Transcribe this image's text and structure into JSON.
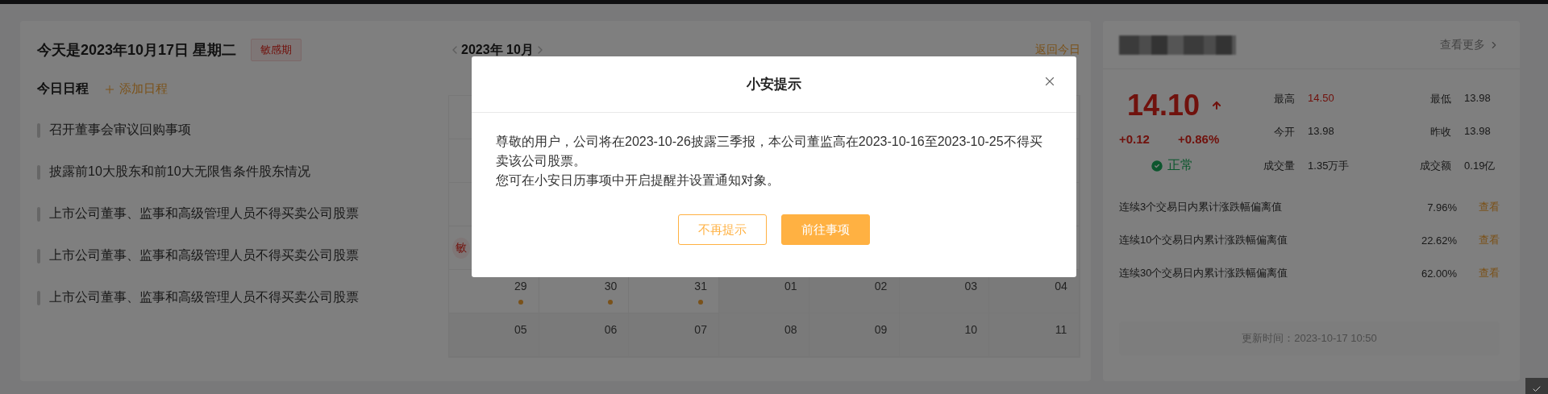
{
  "left_card": {
    "title": "今天是2023年10月17日 星期二",
    "badge": "敏感期",
    "schedule_heading": "今日日程",
    "add_link": "添加日程",
    "schedule": [
      "召开董事会审议回购事项",
      "披露前10大股东和前10大无限售条件股东情况",
      "上市公司董事、监事和高级管理人员不得买卖公司股票",
      "上市公司董事、监事和高级管理人员不得买卖公司股票",
      "上市公司董事、监事和高级管理人员不得买卖公司股票"
    ]
  },
  "calendar": {
    "month": "2023年 10月",
    "today_link": "返回今日",
    "hidden_badge": "敏",
    "rows": [
      {
        "cells": [
          {
            "day": "29",
            "other_month": false,
            "has_event": true
          },
          {
            "day": "30",
            "other_month": false,
            "has_event": true
          },
          {
            "day": "31",
            "other_month": false,
            "has_event": true
          },
          {
            "day": "01",
            "other_month": true,
            "has_event": false
          },
          {
            "day": "02",
            "other_month": true,
            "has_event": false
          },
          {
            "day": "03",
            "other_month": true,
            "has_event": false
          },
          {
            "day": "04",
            "other_month": true,
            "has_event": false
          }
        ]
      },
      {
        "cells": [
          {
            "day": "05",
            "other_month": true,
            "has_event": false
          },
          {
            "day": "06",
            "other_month": true,
            "has_event": false
          },
          {
            "day": "07",
            "other_month": true,
            "has_event": false
          },
          {
            "day": "08",
            "other_month": true,
            "has_event": false
          },
          {
            "day": "09",
            "other_month": true,
            "has_event": false
          },
          {
            "day": "10",
            "other_month": true,
            "has_event": false
          },
          {
            "day": "11",
            "other_month": true,
            "has_event": false
          }
        ]
      }
    ]
  },
  "stock_card": {
    "more_link": "查看更多",
    "price": "14.10",
    "rising": true,
    "change": "+0.12",
    "change_pct": "+0.86%",
    "status": "正常",
    "stats": [
      {
        "label": "最高",
        "value": "14.50",
        "rising": true
      },
      {
        "label": "最低",
        "value": "13.98",
        "rising": false
      },
      {
        "label": "今开",
        "value": "13.98",
        "rising": false
      },
      {
        "label": "昨收",
        "value": "13.98",
        "rising": false
      },
      {
        "label": "成交量",
        "value": "1.35万手",
        "rising": false
      },
      {
        "label": "成交额",
        "value": "0.19亿",
        "rising": false
      }
    ],
    "deviations": [
      {
        "label": "连续3个交易日内累计涨跌幅偏离值",
        "value": "7.96%",
        "link": "查看"
      },
      {
        "label": "连续10个交易日内累计涨跌幅偏离值",
        "value": "22.62%",
        "link": "查看"
      },
      {
        "label": "连续30个交易日内累计涨跌幅偏离值",
        "value": "62.00%",
        "link": "查看"
      }
    ],
    "updated": "更新时间：2023-10-17 10:50"
  },
  "modal": {
    "title": "小安提示",
    "paragraphs": [
      "尊敬的用户，公司将在2023-10-26披露三季报，本公司董监高在2023-10-16至2023-10-25不得买卖该公司股票。",
      "您可在小安日历事项中开启提醒并设置通知对象。"
    ],
    "buttons": [
      {
        "label": "不再提示",
        "kind": "secondary"
      },
      {
        "label": "前往事项",
        "kind": "primary"
      }
    ]
  }
}
